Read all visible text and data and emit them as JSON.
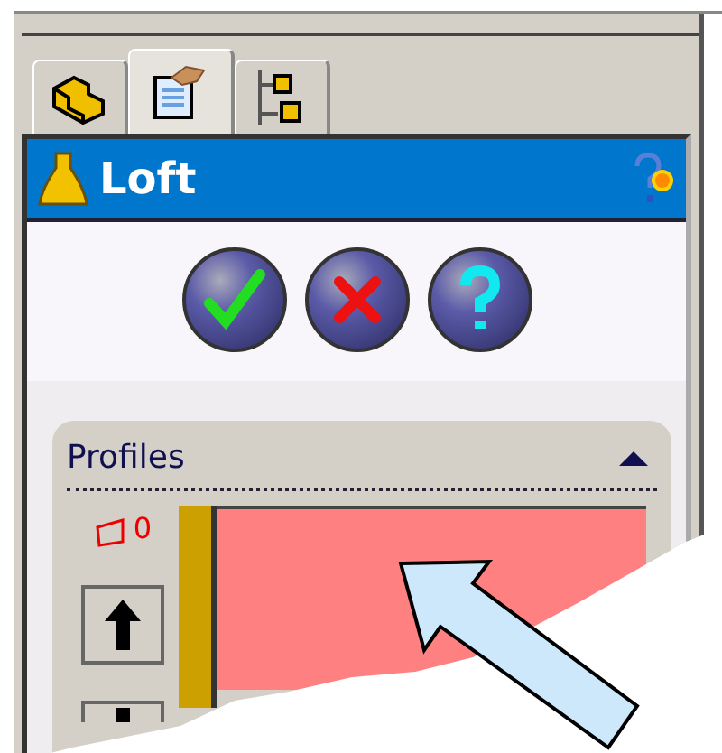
{
  "tabs": [
    {
      "kind": "part",
      "selected": false
    },
    {
      "kind": "properties",
      "selected": true
    },
    {
      "kind": "configurations",
      "selected": false
    }
  ],
  "title": "Loft",
  "actions": [
    {
      "kind": "ok"
    },
    {
      "kind": "cancel"
    },
    {
      "kind": "help"
    }
  ],
  "profiles": {
    "title": "Profiles",
    "expanded": true,
    "count": "0"
  }
}
